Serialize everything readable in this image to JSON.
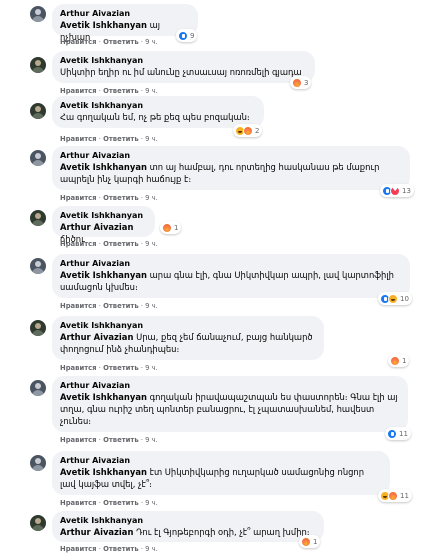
{
  "ui": {
    "like_label": "Нравится",
    "reply_label": "Ответить",
    "separator": "·"
  },
  "comments": [
    {
      "author": "Arthur Aivazian",
      "mention": "Avetik Ishkhanyan",
      "text": " այ ոչխար",
      "time": "9 ч.",
      "reactions": [
        "like"
      ],
      "reaction_count": "9"
    },
    {
      "author": "Avetik Ishkhanyan",
      "mention": "",
      "text": "Սիկտիր եղիր ու իմ անունը չտսաւսայ ոռոռմելի գյադա",
      "time": "9 ч.",
      "reactions": [
        "angry"
      ],
      "reaction_count": "3"
    },
    {
      "author": "Avetik Ishkhanyan",
      "mention": "",
      "text": "Հա գողական եմ, ոչ թե քեզ պես բոզական։",
      "time": "9 ч.",
      "reactions": [
        "haha",
        "angry"
      ],
      "reaction_count": "2"
    },
    {
      "author": "Arthur Aivazian",
      "mention": "Avetik Ishkhanyan",
      "text": " տո այ համբալ, դու որտեղից հասկանաս թե մաքուր ապրելն ինչ կարգի հաճույք է։",
      "time": "9 ч.",
      "reactions": [
        "like",
        "love"
      ],
      "reaction_count": "13"
    },
    {
      "author": "Avetik Ishkhanyan",
      "mention": "Arthur Aivazian",
      "text": " ճիծու",
      "time": "9 ч.",
      "reactions": [
        "angry"
      ],
      "reaction_count": "1"
    },
    {
      "author": "Arthur Aivazian",
      "mention": "Avetik Ishkhanyan",
      "text": " արա գնա էլի, գնա Սիկտիվկար ապրի, լավ կարտոֆիլի սամացոն կխմես։",
      "time": "9 ч.",
      "reactions": [
        "like",
        "haha"
      ],
      "reaction_count": "10"
    },
    {
      "author": "Avetik Ishkhanyan",
      "mention": "Arthur Aivazian",
      "text": " Սրա, քեզ չեմ ճանաչում, բայց հանկարծ փողոցում ինձ չհանդիպես։",
      "time": "9 ч.",
      "reactions": [
        "angry"
      ],
      "reaction_count": "1"
    },
    {
      "author": "Arthur Aivazian",
      "mention": "Avetik Ishkhanyan",
      "text": " գողական իրավապաշտպան ես փաստորեն։ Գնա էլի այ տղա, գնա ուրիշ տեղ պոնտեր բանացրու, էլ չպատասխանեմ, հավեստ չունես։",
      "time": "9 ч.",
      "reactions": [
        "like"
      ],
      "reaction_count": "11"
    },
    {
      "author": "Arthur Aivazian",
      "mention": "Avetik Ishkhanyan",
      "text": " էտ Սիկտիվկարից ուղարկած սամացոնից ոնցոր լավ կայֆա տվել, չէ՞։",
      "time": "9 ч.",
      "reactions": [
        "haha",
        "angry"
      ],
      "reaction_count": "11"
    },
    {
      "author": "Avetik Ishkhanyan",
      "mention": "Arthur Aivazian",
      "text": " Դու էլ Գյոթեբորգի օդի, չէ՞ արաղ խմիր։",
      "time": "9 ч.",
      "reactions": [
        "angry"
      ],
      "reaction_count": "1"
    }
  ]
}
